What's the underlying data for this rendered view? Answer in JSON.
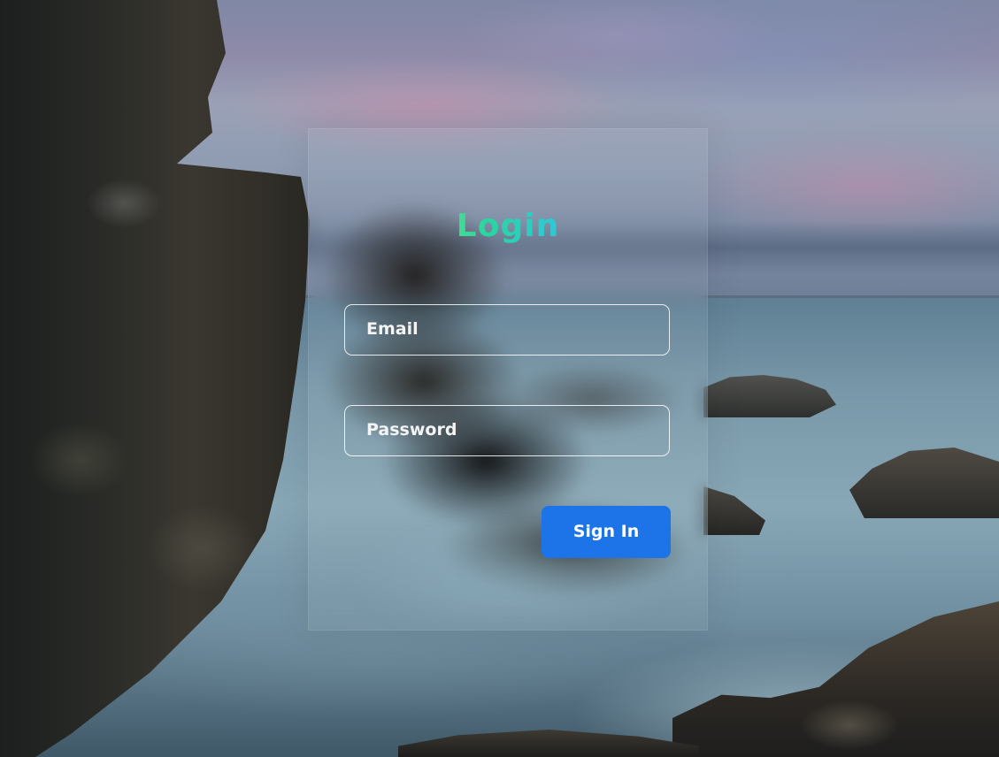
{
  "login": {
    "title": "Login",
    "email_placeholder": "Email",
    "password_placeholder": "Password",
    "signin_label": "Sign In"
  },
  "colors": {
    "button_bg": "#1c74e8",
    "title_gradient": [
      "#e6e23a",
      "#28d6a0",
      "#2ec9d6",
      "#f0f0ff"
    ],
    "field_border": "#ffffff"
  }
}
